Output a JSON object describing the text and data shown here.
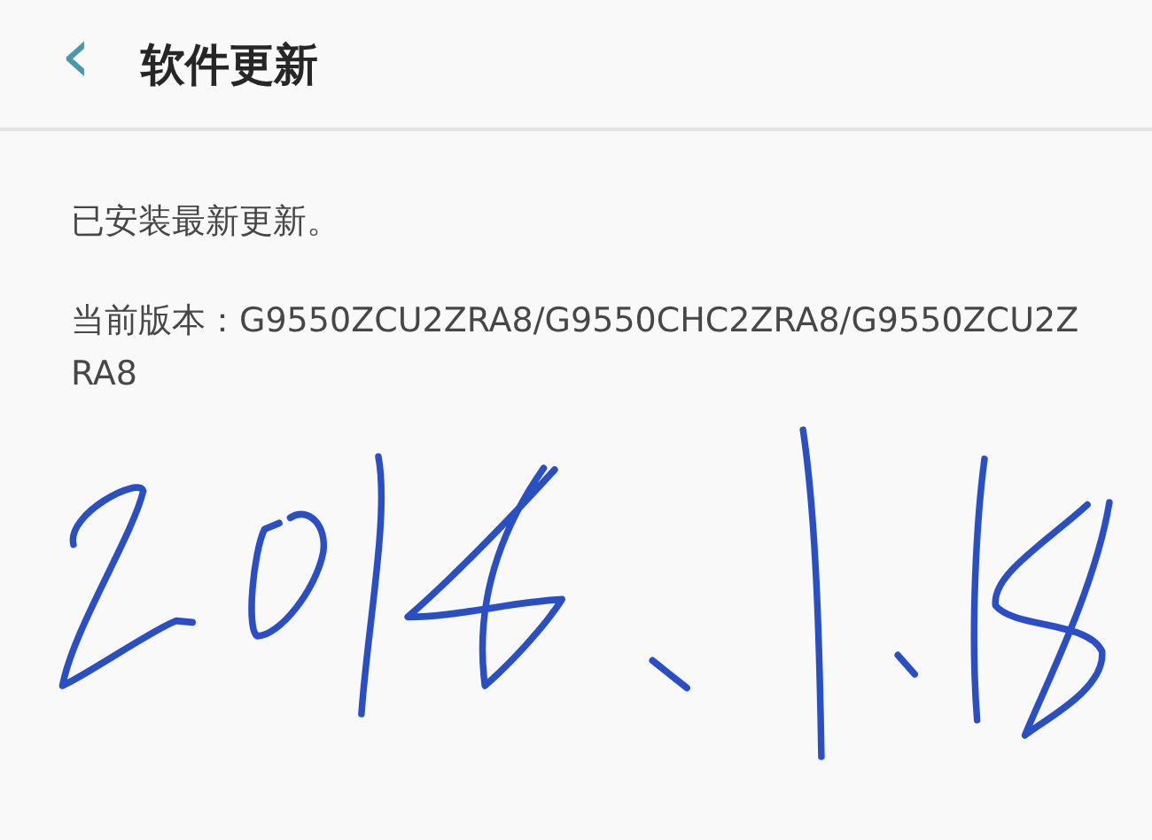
{
  "header": {
    "back": "‹",
    "title": "软件更新"
  },
  "status": "已安装最新更新。",
  "version": {
    "label": "当前版本：",
    "value": "G9550ZCU2ZRA8/G9550CHC2ZRA8/G9550ZCU2ZRA8"
  }
}
